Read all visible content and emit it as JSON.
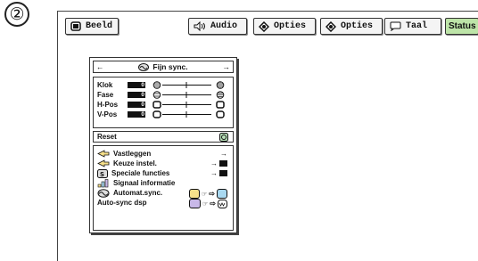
{
  "step_number": "②",
  "tabs": [
    {
      "label": "Beeld",
      "icon": "picture-icon"
    },
    {
      "label": "Audio",
      "icon": "speaker-icon"
    },
    {
      "label": "Opties",
      "icon": "options-icon"
    },
    {
      "label": "Opties",
      "icon": "options-icon"
    },
    {
      "label": "Taal",
      "icon": "speech-bubble-icon"
    },
    {
      "label": "Status",
      "icon": ""
    }
  ],
  "panel": {
    "title": "Fijn sync.",
    "adjust_rows": [
      {
        "label": "Klok",
        "value": "0",
        "level": 0.5
      },
      {
        "label": "Fase",
        "value": "0",
        "level": 0.5
      },
      {
        "label": "H-Pos",
        "value": "0",
        "level": 0.5
      },
      {
        "label": "V-Pos",
        "value": "0",
        "level": 0.5
      }
    ],
    "reset_label": "Reset",
    "options": [
      {
        "label": "Vastleggen"
      },
      {
        "label": "Keuze instel."
      },
      {
        "label": "Speciale functies"
      },
      {
        "label": "Signaal informatie"
      },
      {
        "label": "Automat.sync."
      },
      {
        "label": "Auto-sync dsp"
      }
    ]
  },
  "colors": {
    "active_tab": "#bde4a8",
    "toggle_yellow": "#f6e08a",
    "toggle_blue": "#a8d8f0",
    "toggle_purple": "#c8b8e8"
  }
}
